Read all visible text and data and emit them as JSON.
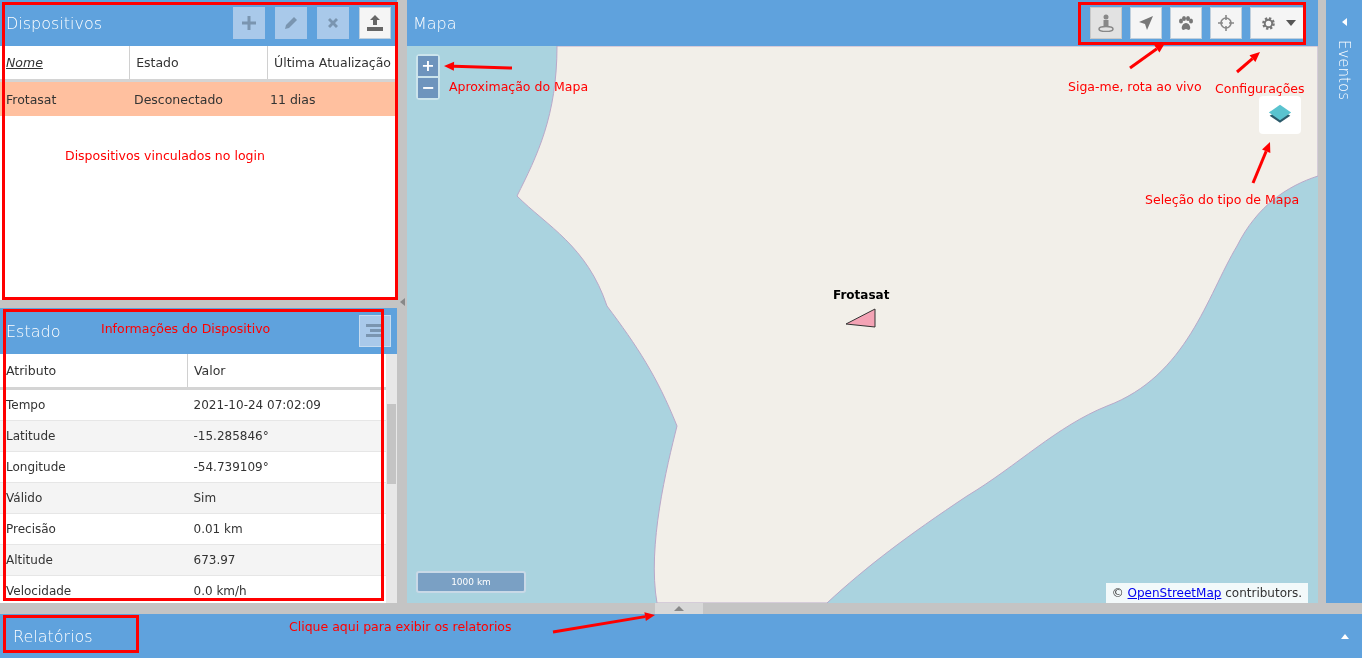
{
  "devices_panel": {
    "title": "Dispositivos",
    "tools": [
      {
        "disabled": true
      },
      {
        "disabled": true
      },
      {
        "disabled": true
      },
      {
        "disabled": false
      }
    ],
    "columns": [
      {
        "label": "Nome",
        "sorted": true
      },
      {
        "label": "Estado",
        "sorted": false
      },
      {
        "label": "Última Atualização",
        "sorted": false
      }
    ],
    "rows": [
      {
        "cells": [
          "Frotasat",
          "Desconectado",
          "11 dias"
        ],
        "selected": true
      }
    ]
  },
  "state_panel": {
    "title": "Estado",
    "columns": [
      "Atributo",
      "Valor"
    ],
    "rows": [
      {
        "attribute": "Tempo",
        "value": "2021-10-24 07:02:09"
      },
      {
        "attribute": "Latitude",
        "value": "-15.285846°"
      },
      {
        "attribute": "Longitude",
        "value": "-54.739109°"
      },
      {
        "attribute": "Válido",
        "value": "Sim"
      },
      {
        "attribute": "Precisão",
        "value": "0.01 km"
      },
      {
        "attribute": "Altitude",
        "value": "673.97"
      },
      {
        "attribute": "Velocidade",
        "value": "0.0 km/h"
      }
    ]
  },
  "map_panel": {
    "title": "Mapa",
    "tools": [
      {
        "active": true
      },
      {
        "active": false
      },
      {
        "active": false
      },
      {
        "active": false
      },
      {
        "active": false
      }
    ],
    "zoom_buttons": [
      "+",
      "−"
    ],
    "marker": {
      "label": "Frotasat"
    },
    "scale": "1000 km",
    "attribution": {
      "prefix": "©",
      "link": "OpenStreetMap",
      "suffix": "contributors."
    }
  },
  "events_sidebar": {
    "title": "Eventos"
  },
  "reports_bar": {
    "title": "Relatórios"
  },
  "annotations": [
    "Dispositivos vinculados no login",
    "Informações do Dispositivo",
    "Aproximação do Mapa",
    "Siga-me, rota ao vivo",
    "Configurações",
    "Seleção do tipo de Mapa",
    "Clique aqui para exibir os relatorios"
  ]
}
